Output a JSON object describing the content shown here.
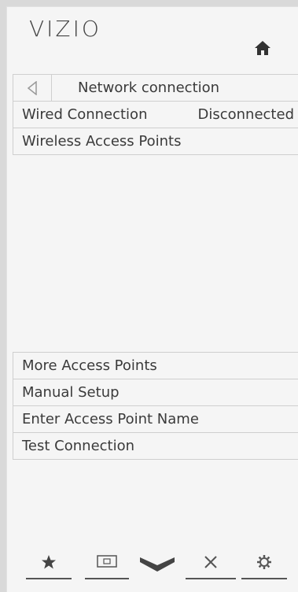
{
  "brand": {
    "logo_text": "VIZIO"
  },
  "header": {
    "title": "Network connection"
  },
  "menu_top": [
    {
      "label": "Wired Connection",
      "value": "Disconnected"
    },
    {
      "label": "Wireless Access Points",
      "value": ""
    }
  ],
  "menu_bottom": [
    {
      "label": "More Access Points"
    },
    {
      "label": "Manual Setup"
    },
    {
      "label": "Enter Access Point Name"
    },
    {
      "label": "Test Connection"
    }
  ],
  "nav_icons": [
    "star-icon",
    "input-icon",
    "chevron-down-icon",
    "close-icon",
    "gear-icon"
  ],
  "colors": {
    "background": "#f5f5f5",
    "text": "#3a3a3a",
    "border": "#cfcfcf"
  }
}
